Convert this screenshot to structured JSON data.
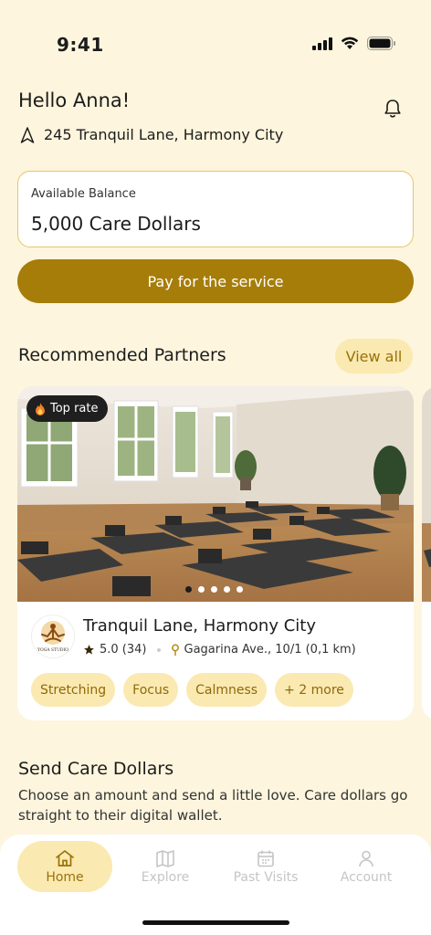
{
  "status": {
    "time": "9:41"
  },
  "header": {
    "greeting": "Hello Anna!",
    "address": "245 Tranquil Lane, Harmony City"
  },
  "balance": {
    "label": "Available Balance",
    "value": "5,000 Care Dollars"
  },
  "pay_button": "Pay for the service",
  "recommended": {
    "title": "Recommended Partners",
    "view_all": "View all",
    "partner": {
      "badge": "Top rate",
      "name": "Tranquil Lane, Harmony City",
      "rating": "5.0 (34)",
      "address": "Gagarina Ave., 10/1 (0,1 km)",
      "logo_text": "YOGA STUDIO",
      "tags": [
        "Stretching",
        "Focus",
        "Calmness",
        "+ 2 more"
      ],
      "carousel": {
        "count": 5,
        "active": 1
      }
    }
  },
  "send": {
    "title": "Send Care Dollars",
    "description": "Choose an amount and send a little love. Care dollars go straight to their digital wallet."
  },
  "tabs": [
    {
      "label": "Home",
      "icon": "home-icon",
      "active": true
    },
    {
      "label": "Explore",
      "icon": "map-icon",
      "active": false
    },
    {
      "label": "Past Visits",
      "icon": "calendar-icon",
      "active": false
    },
    {
      "label": "Account",
      "icon": "user-icon",
      "active": false
    }
  ],
  "colors": {
    "accent": "#A77D0A",
    "background": "#FDF5DD",
    "chip": "#FBE9B2"
  }
}
